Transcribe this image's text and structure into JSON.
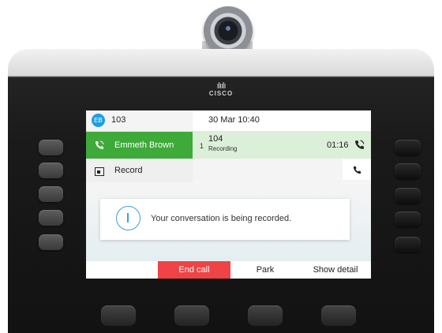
{
  "header": {
    "avatar_initials": "EB",
    "line_number": "103",
    "datetime": "30 Mar 10:40"
  },
  "logo": {
    "glyph": "ılıılı",
    "word": "CISCO"
  },
  "active_call": {
    "caller_name": "Emmeth Brown",
    "index": "1",
    "number": "104",
    "status": "Recording",
    "timer": "01:16"
  },
  "record_row": {
    "label": "Record"
  },
  "notification": {
    "message": "Your conversation is being recorded."
  },
  "softkeys": {
    "end_call": "End call",
    "park": "Park",
    "show_detail": "Show detail"
  },
  "colors": {
    "active_call_green": "#3eaa3a",
    "active_call_light": "#dcefd8",
    "end_call_red": "#ef4345",
    "info_blue": "#3aa0d8",
    "avatar_blue": "#1e9ee0"
  },
  "icons": {
    "call_icon": "handset-icon",
    "record_icon": "record-icon",
    "info_icon": "info-icon"
  }
}
